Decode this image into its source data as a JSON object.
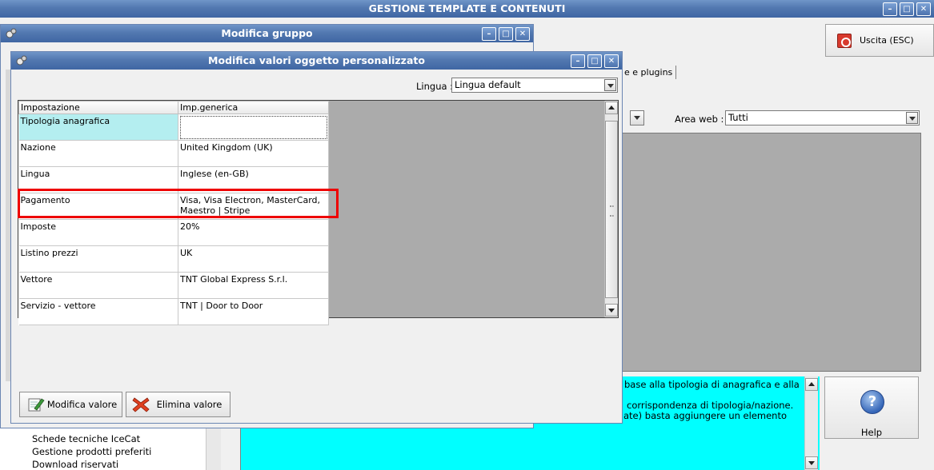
{
  "main_window": {
    "title": "GESTIONE TEMPLATE E CONTENUTI",
    "exit_label": "Uscita (ESC)",
    "tab_label": "e e plugins",
    "area_web_label": "Area web :",
    "area_web_value": "Tutti",
    "help_label": "Help",
    "help_text": [
      "base alla tipologia di anagrafica e alla",
      "corrispondenza di tipologia/nazione.",
      "ate) basta aggiungere un elemento"
    ],
    "tree_items": [
      "Schede tecniche IceCat",
      "Gestione prodotti preferiti",
      "Download riservati"
    ]
  },
  "group_window": {
    "title": "Modifica gruppo"
  },
  "dialog": {
    "title": "Modifica valori oggetto personalizzato",
    "lingua_label": "Lingua :",
    "lingua_value": "Lingua default",
    "columns": [
      "Impostazione",
      "Imp.generica"
    ],
    "rows": [
      {
        "setting": "Tipologia anagrafica",
        "value": ""
      },
      {
        "setting": "Nazione",
        "value": "United Kingdom (UK)"
      },
      {
        "setting": "Lingua",
        "value": "Inglese (en-GB)"
      },
      {
        "setting": "Pagamento",
        "value_line1": "Visa, Visa Electron, MasterCard,",
        "value_line2": "Maestro | Stripe"
      },
      {
        "setting": "Imposte",
        "value": "20%"
      },
      {
        "setting": "Listino prezzi",
        "value": "UK"
      },
      {
        "setting": "Vettore",
        "value": "TNT Global Express S.r.l."
      },
      {
        "setting": "Servizio - vettore",
        "value": "TNT | Door to Door"
      }
    ],
    "edit_button": "Modifica valore",
    "delete_button": "Elimina valore"
  },
  "colors": {
    "titlebar": "#5278b0",
    "selected_cell": "#b4eef0",
    "highlight": "#ee0000",
    "info_panel": "#00ffff"
  }
}
